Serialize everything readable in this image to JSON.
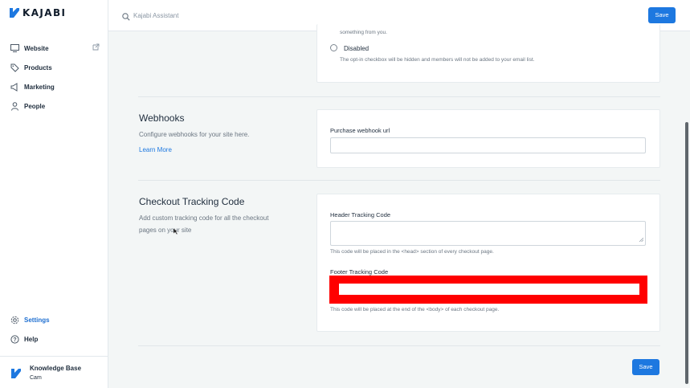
{
  "sidebar": {
    "logo_text": "KAJABI",
    "items": [
      {
        "label": "Website",
        "icon": "monitor-icon"
      },
      {
        "label": "Products",
        "icon": "tag-icon"
      },
      {
        "label": "Marketing",
        "icon": "megaphone-icon"
      },
      {
        "label": "People",
        "icon": "person-icon"
      }
    ],
    "bottom_items": [
      {
        "label": "Settings",
        "icon": "gear-icon",
        "active": true
      },
      {
        "label": "Help",
        "icon": "help-icon"
      }
    ],
    "account": {
      "title": "Knowledge Base",
      "subtitle": "Cam"
    }
  },
  "topbar": {
    "search_placeholder": "Kajabi Assistant",
    "save_label": "Save"
  },
  "optin": {
    "faded_text": "something from you.",
    "disabled_label": "Disabled",
    "disabled_help": "The opt-in checkbox will be hidden and members will not be added to your email list."
  },
  "webhooks": {
    "title": "Webhooks",
    "description": "Configure webhooks for your site here.",
    "link": "Learn More",
    "field_label": "Purchase webhook url",
    "field_value": ""
  },
  "tracking": {
    "title": "Checkout Tracking Code",
    "description": "Add custom tracking code for all the checkout pages on your site",
    "header_label": "Header Tracking Code",
    "header_help": "This code will be placed in the <head> section of every checkout page.",
    "footer_label": "Footer Tracking Code",
    "footer_help": "This code will be placed at the end of the <body> of each checkout page."
  },
  "footer": {
    "save_label": "Save"
  },
  "colors": {
    "accent": "#1d78e0",
    "highlight": "#ff0000"
  }
}
